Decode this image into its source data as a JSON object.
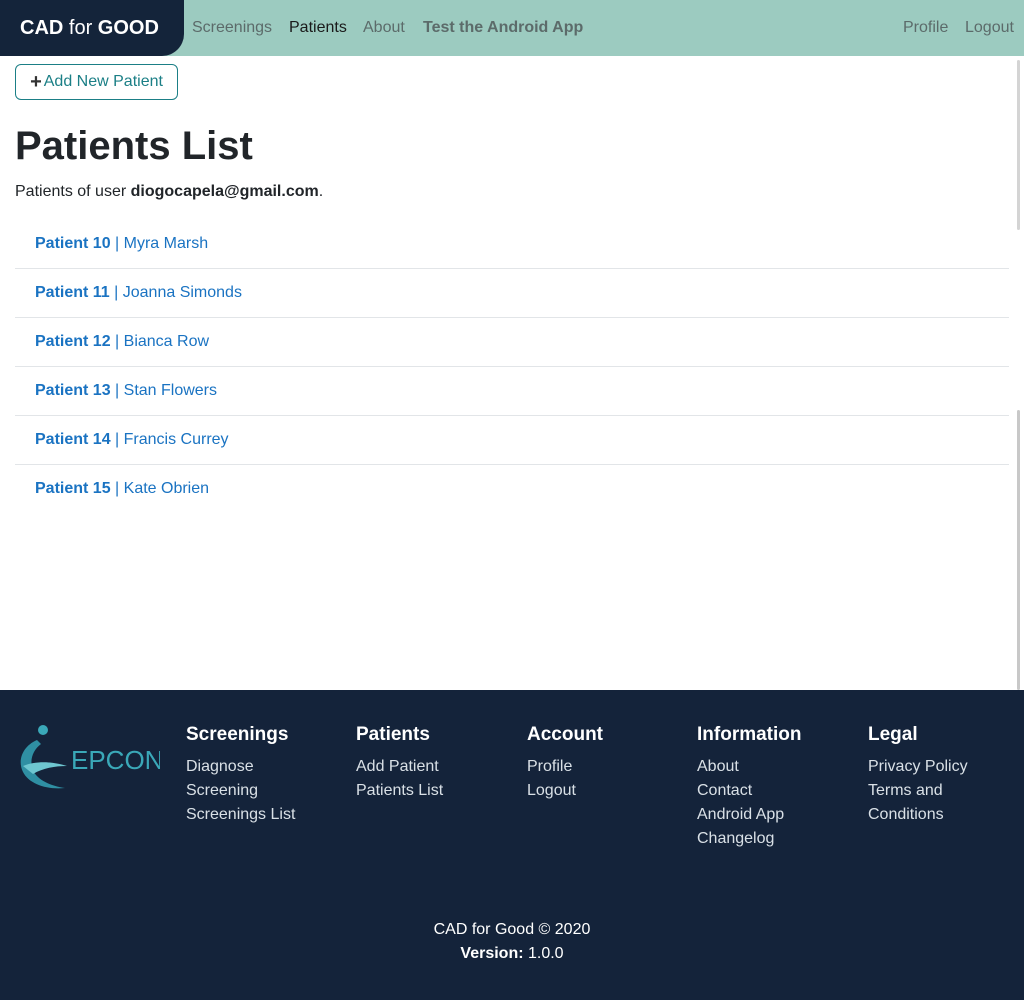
{
  "navbar": {
    "brand_bold1": "CAD",
    "brand_for": " for ",
    "brand_bold2": "GOOD",
    "links": [
      {
        "label": "Screenings"
      },
      {
        "label": "Patients"
      },
      {
        "label": "About"
      },
      {
        "label": "Test the Android App"
      }
    ],
    "profile": "Profile",
    "logout": "Logout"
  },
  "actions": {
    "add_patient": "Add New Patient"
  },
  "page": {
    "title": "Patients List",
    "subtitle_prefix": "Patients of user ",
    "user_email": "diogocapela@gmail.com",
    "subtitle_suffix": "."
  },
  "patients": [
    {
      "id": "Patient 10",
      "name": " | Myra Marsh"
    },
    {
      "id": "Patient 11",
      "name": " | Joanna Simonds"
    },
    {
      "id": "Patient 12",
      "name": " | Bianca Row"
    },
    {
      "id": "Patient 13",
      "name": " | Stan Flowers"
    },
    {
      "id": "Patient 14",
      "name": " | Francis Currey"
    },
    {
      "id": "Patient 15",
      "name": " | Kate Obrien"
    }
  ],
  "footer": {
    "logo_text": "EPCON",
    "columns": [
      {
        "title": "Screenings",
        "links": [
          "Diagnose",
          "Screening",
          "Screenings List"
        ]
      },
      {
        "title": "Patients",
        "links": [
          "Add Patient",
          "Patients List"
        ]
      },
      {
        "title": "Account",
        "links": [
          "Profile",
          "Logout"
        ]
      },
      {
        "title": "Information",
        "links": [
          "About",
          "Contact",
          "Android App",
          "Changelog"
        ]
      },
      {
        "title": "Legal",
        "links": [
          "Privacy Policy",
          "Terms and",
          "Conditions"
        ]
      }
    ],
    "copyright": "CAD for Good © 2020",
    "version_label": "Version:",
    "version_value": " 1.0.0"
  },
  "colors": {
    "navbar_bg": "#9ccbc0",
    "brand_bg": "#14243a",
    "link_blue": "#1a73c2",
    "button_teal": "#1b7f86",
    "footer_bg": "#14233a"
  }
}
